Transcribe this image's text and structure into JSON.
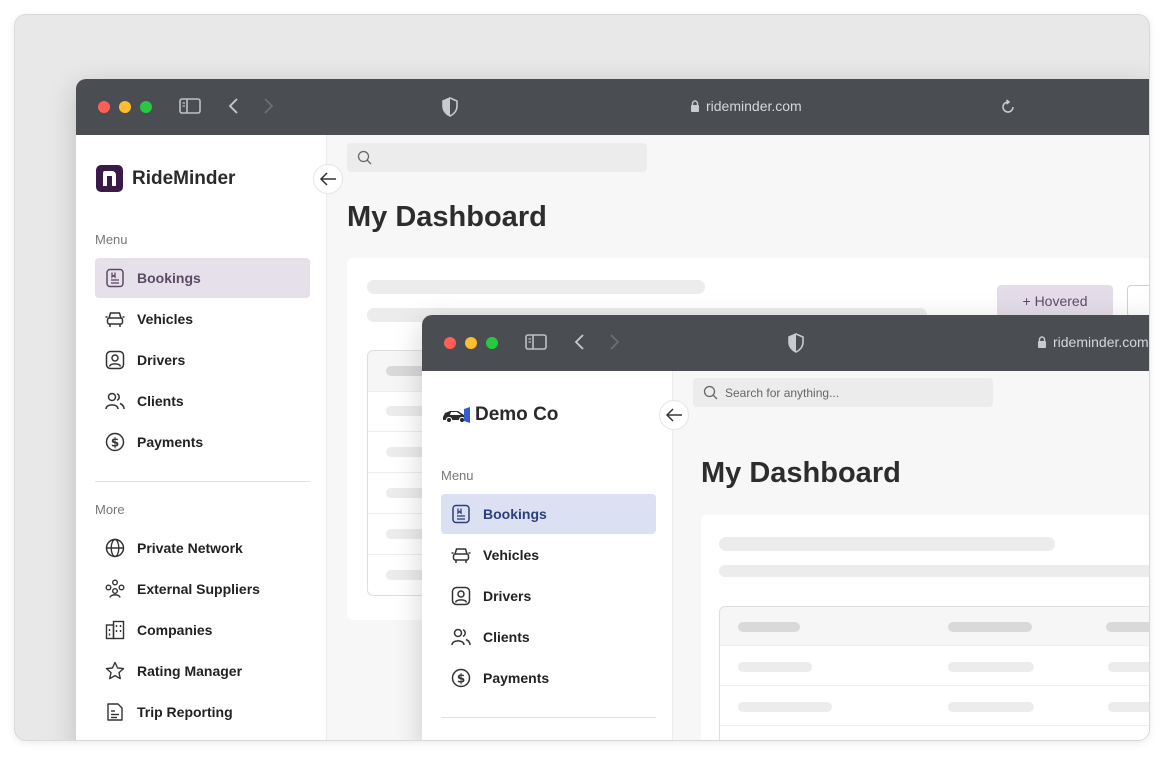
{
  "colors": {
    "titlebar": "#4a4d52",
    "rideminder_accent": "#e6e0eb",
    "democo_accent": "#dbe0f3",
    "rideminder_brand": "#3b1a4a"
  },
  "back_window": {
    "url": "rideminder.com",
    "brand_name": "RideMinder",
    "menu_label": "Menu",
    "menu_items": [
      {
        "label": "Bookings",
        "icon": "bookings-icon",
        "active": true
      },
      {
        "label": "Vehicles",
        "icon": "vehicle-icon"
      },
      {
        "label": "Drivers",
        "icon": "driver-icon"
      },
      {
        "label": "Clients",
        "icon": "clients-icon"
      },
      {
        "label": "Payments",
        "icon": "payments-icon"
      }
    ],
    "more_label": "More",
    "more_items": [
      {
        "label": "Private Network",
        "icon": "globe-icon"
      },
      {
        "label": "External Suppliers",
        "icon": "suppliers-icon"
      },
      {
        "label": "Companies",
        "icon": "companies-icon"
      },
      {
        "label": "Rating Manager",
        "icon": "star-icon"
      },
      {
        "label": "Trip Reporting",
        "icon": "report-icon"
      }
    ],
    "page_title": "My Dashboard",
    "hovered_button": "+  Hovered"
  },
  "front_window": {
    "url": "rideminder.com",
    "brand_name": "Demo Co",
    "search_placeholder": "Search for anything...",
    "menu_label": "Menu",
    "menu_items": [
      {
        "label": "Bookings",
        "icon": "bookings-icon",
        "active": true
      },
      {
        "label": "Vehicles",
        "icon": "vehicle-icon"
      },
      {
        "label": "Drivers",
        "icon": "driver-icon"
      },
      {
        "label": "Clients",
        "icon": "clients-icon"
      },
      {
        "label": "Payments",
        "icon": "payments-icon"
      }
    ],
    "page_title": "My Dashboard"
  }
}
